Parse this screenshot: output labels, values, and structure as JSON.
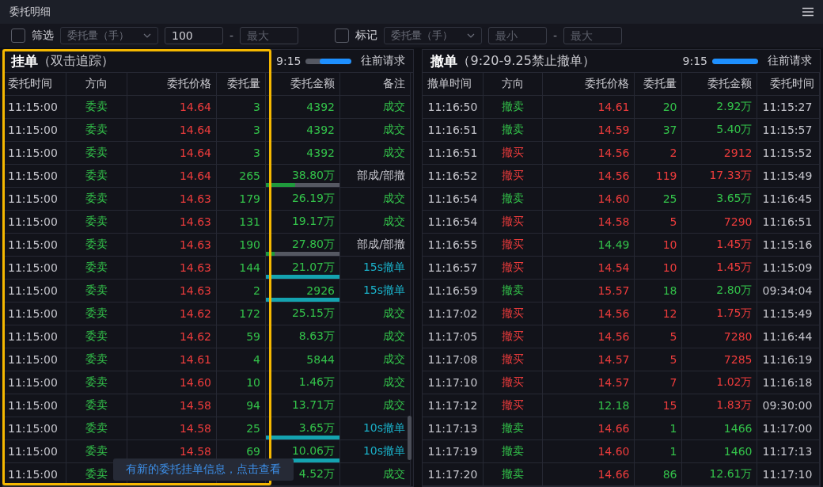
{
  "window": {
    "title": "委托明细"
  },
  "filters": [
    {
      "label": "筛选",
      "checked": false,
      "dropdown": "委托量（手）",
      "min": {
        "value": "100"
      },
      "max": {
        "placeholder": "最大"
      },
      "separator": "-"
    },
    {
      "label": "标记",
      "checked": false,
      "dropdown": "委托量（手）",
      "min": {
        "placeholder": "最小"
      },
      "max": {
        "placeholder": "最大"
      },
      "separator": "-"
    }
  ],
  "pending": {
    "title": "挂单",
    "subtitle": "（双击追踪）",
    "time": "9:15",
    "progress": {
      "level": 0.7
    },
    "more": "往前请求",
    "columns": [
      "委托时间",
      "方向",
      "委托价格",
      "委托量",
      "委托金额",
      "备注"
    ],
    "rows": [
      {
        "time": "11:15:00",
        "buy": false,
        "direction": "委卖",
        "price": "14.64",
        "qty": "3",
        "amount": "4392",
        "remark": "成交",
        "kind": "filled"
      },
      {
        "time": "11:15:00",
        "buy": false,
        "direction": "委卖",
        "price": "14.64",
        "qty": "3",
        "amount": "4392",
        "remark": "成交",
        "kind": "filled"
      },
      {
        "time": "11:15:00",
        "buy": false,
        "direction": "委卖",
        "price": "14.64",
        "qty": "3",
        "amount": "4392",
        "remark": "成交",
        "kind": "filled"
      },
      {
        "time": "11:15:00",
        "buy": false,
        "direction": "委卖",
        "price": "14.64",
        "qty": "265",
        "amount": "38.80万",
        "remark": "部成/部撤",
        "kind": "partial",
        "level": 0.4
      },
      {
        "time": "11:15:00",
        "buy": false,
        "direction": "委卖",
        "price": "14.63",
        "qty": "179",
        "amount": "26.19万",
        "remark": "成交",
        "kind": "filled"
      },
      {
        "time": "11:15:00",
        "buy": false,
        "direction": "委卖",
        "price": "14.63",
        "qty": "131",
        "amount": "19.17万",
        "remark": "成交",
        "kind": "filled"
      },
      {
        "time": "11:15:00",
        "buy": false,
        "direction": "委卖",
        "price": "14.63",
        "qty": "190",
        "amount": "27.80万",
        "remark": "部成/部撤",
        "kind": "partial",
        "level": 0.12
      },
      {
        "time": "11:15:00",
        "buy": false,
        "direction": "委卖",
        "price": "14.63",
        "qty": "144",
        "amount": "21.07万",
        "remark": "15s撤单",
        "kind": "cancelled"
      },
      {
        "time": "11:15:00",
        "buy": false,
        "direction": "委卖",
        "price": "14.63",
        "qty": "2",
        "amount": "2926",
        "remark": "15s撤单",
        "kind": "cancelled"
      },
      {
        "time": "11:15:00",
        "buy": false,
        "direction": "委卖",
        "price": "14.62",
        "qty": "172",
        "amount": "25.15万",
        "remark": "成交",
        "kind": "filled"
      },
      {
        "time": "11:15:00",
        "buy": false,
        "direction": "委卖",
        "price": "14.62",
        "qty": "59",
        "amount": "8.63万",
        "remark": "成交",
        "kind": "filled"
      },
      {
        "time": "11:15:00",
        "buy": false,
        "direction": "委卖",
        "price": "14.61",
        "qty": "4",
        "amount": "5844",
        "remark": "成交",
        "kind": "filled"
      },
      {
        "time": "11:15:00",
        "buy": false,
        "direction": "委卖",
        "price": "14.60",
        "qty": "10",
        "amount": "1.46万",
        "remark": "成交",
        "kind": "filled"
      },
      {
        "time": "11:15:00",
        "buy": false,
        "direction": "委卖",
        "price": "14.58",
        "qty": "94",
        "amount": "13.71万",
        "remark": "成交",
        "kind": "filled"
      },
      {
        "time": "11:15:00",
        "buy": false,
        "direction": "委卖",
        "price": "14.58",
        "qty": "25",
        "amount": "3.65万",
        "remark": "10s撤单",
        "kind": "cancelled"
      },
      {
        "time": "11:15:00",
        "buy": false,
        "direction": "委卖",
        "price": "14.58",
        "qty": "69",
        "amount": "10.06万",
        "remark": "10s撤单",
        "kind": "cancelled"
      },
      {
        "time": "11:15:00",
        "buy": false,
        "direction": "委卖",
        "amount": "4.52万",
        "remark": "成交",
        "kind": "filled"
      }
    ]
  },
  "cancelled": {
    "title": "撤单",
    "subtitle": "（9:20-9.25禁止撤单）",
    "time": "9:15",
    "progress": {
      "level": 1
    },
    "more": "往前请求",
    "columns": [
      "撤单时间",
      "方向",
      "委托价格",
      "委托量",
      "委托金额",
      "委托时间"
    ],
    "rows": [
      {
        "time": "11:16:50",
        "buy": false,
        "direction": "撤卖",
        "price": "14.61",
        "price_up": true,
        "qty": "20",
        "amount": "2.92万",
        "order_time": "11:15:27"
      },
      {
        "time": "11:16:51",
        "buy": false,
        "direction": "撤卖",
        "price": "14.59",
        "price_up": true,
        "qty": "37",
        "amount": "5.40万",
        "order_time": "11:15:57"
      },
      {
        "time": "11:16:51",
        "buy": true,
        "direction": "撤买",
        "price": "14.56",
        "price_up": true,
        "qty": "2",
        "amount": "2912",
        "order_time": "11:15:52"
      },
      {
        "time": "11:16:52",
        "buy": true,
        "direction": "撤买",
        "price": "14.56",
        "price_up": true,
        "qty": "119",
        "amount": "17.33万",
        "order_time": "11:15:49"
      },
      {
        "time": "11:16:54",
        "buy": false,
        "direction": "撤卖",
        "price": "14.60",
        "price_up": true,
        "qty": "25",
        "amount": "3.65万",
        "order_time": "11:16:45"
      },
      {
        "time": "11:16:54",
        "buy": true,
        "direction": "撤买",
        "price": "14.58",
        "price_up": true,
        "qty": "5",
        "amount": "7290",
        "order_time": "11:16:51"
      },
      {
        "time": "11:16:55",
        "buy": true,
        "direction": "撤买",
        "price": "14.49",
        "price_up": false,
        "qty": "10",
        "amount": "1.45万",
        "order_time": "11:15:16"
      },
      {
        "time": "11:16:57",
        "buy": true,
        "direction": "撤买",
        "price": "14.54",
        "price_up": true,
        "qty": "10",
        "amount": "1.45万",
        "order_time": "11:15:09"
      },
      {
        "time": "11:16:59",
        "buy": false,
        "direction": "撤卖",
        "price": "15.57",
        "price_up": true,
        "qty": "18",
        "amount": "2.80万",
        "order_time": "09:34:04"
      },
      {
        "time": "11:17:02",
        "buy": true,
        "direction": "撤买",
        "price": "14.56",
        "price_up": true,
        "qty": "12",
        "amount": "1.75万",
        "order_time": "11:15:49"
      },
      {
        "time": "11:17:05",
        "buy": true,
        "direction": "撤买",
        "price": "14.56",
        "price_up": true,
        "qty": "5",
        "amount": "7280",
        "order_time": "11:16:44"
      },
      {
        "time": "11:17:08",
        "buy": true,
        "direction": "撤买",
        "price": "14.57",
        "price_up": true,
        "qty": "5",
        "amount": "7285",
        "order_time": "11:16:19"
      },
      {
        "time": "11:17:10",
        "buy": true,
        "direction": "撤买",
        "price": "14.57",
        "price_up": true,
        "qty": "7",
        "amount": "1.02万",
        "order_time": "11:16:18"
      },
      {
        "time": "11:17:12",
        "buy": true,
        "direction": "撤买",
        "price": "12.18",
        "price_up": false,
        "qty": "15",
        "amount": "1.83万",
        "order_time": "09:30:00"
      },
      {
        "time": "11:17:13",
        "buy": false,
        "direction": "撤卖",
        "price": "14.66",
        "price_up": true,
        "qty": "1",
        "amount": "1466",
        "order_time": "11:17:00"
      },
      {
        "time": "11:17:19",
        "buy": false,
        "direction": "撤卖",
        "price": "14.60",
        "price_up": true,
        "qty": "1",
        "amount": "1460",
        "order_time": "11:17:13"
      },
      {
        "time": "11:17:20",
        "buy": false,
        "direction": "撤卖",
        "price": "14.66",
        "price_up": true,
        "qty": "86",
        "amount": "12.61万",
        "order_time": "11:17:10"
      }
    ]
  },
  "toast": "有新的委托挂单信息，点击查看"
}
